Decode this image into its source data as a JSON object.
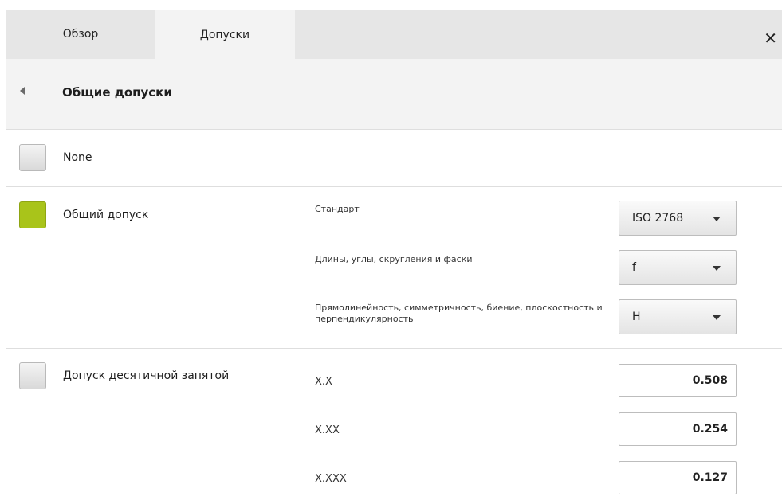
{
  "tabs": [
    {
      "label": "Обзор",
      "active": false
    },
    {
      "label": "Допуски",
      "active": true
    }
  ],
  "header": {
    "title": "Общие допуски"
  },
  "options": {
    "none": {
      "label": "None",
      "checked": false
    },
    "general": {
      "label": "Общий допуск",
      "checked": true,
      "fields": {
        "standard": {
          "label": "Стандарт",
          "value": "ISO 2768"
        },
        "lengths": {
          "label": "Длины, углы, скругления и фаски",
          "value": "f"
        },
        "form": {
          "label": "Прямолинейность, симметричность, биение, плоскостность и перпендикулярность",
          "value": "H"
        }
      }
    },
    "decimal": {
      "label": "Допуск десятичной запятой",
      "checked": false,
      "fields": [
        {
          "label": "X.X",
          "value": "0.508"
        },
        {
          "label": "X.XX",
          "value": "0.254"
        },
        {
          "label": "X.XXX",
          "value": "0.127"
        }
      ]
    }
  },
  "colors": {
    "checked": "#a9c41a",
    "tab_bar": "#e6e6e6",
    "active_tab": "#f3f3f3"
  }
}
